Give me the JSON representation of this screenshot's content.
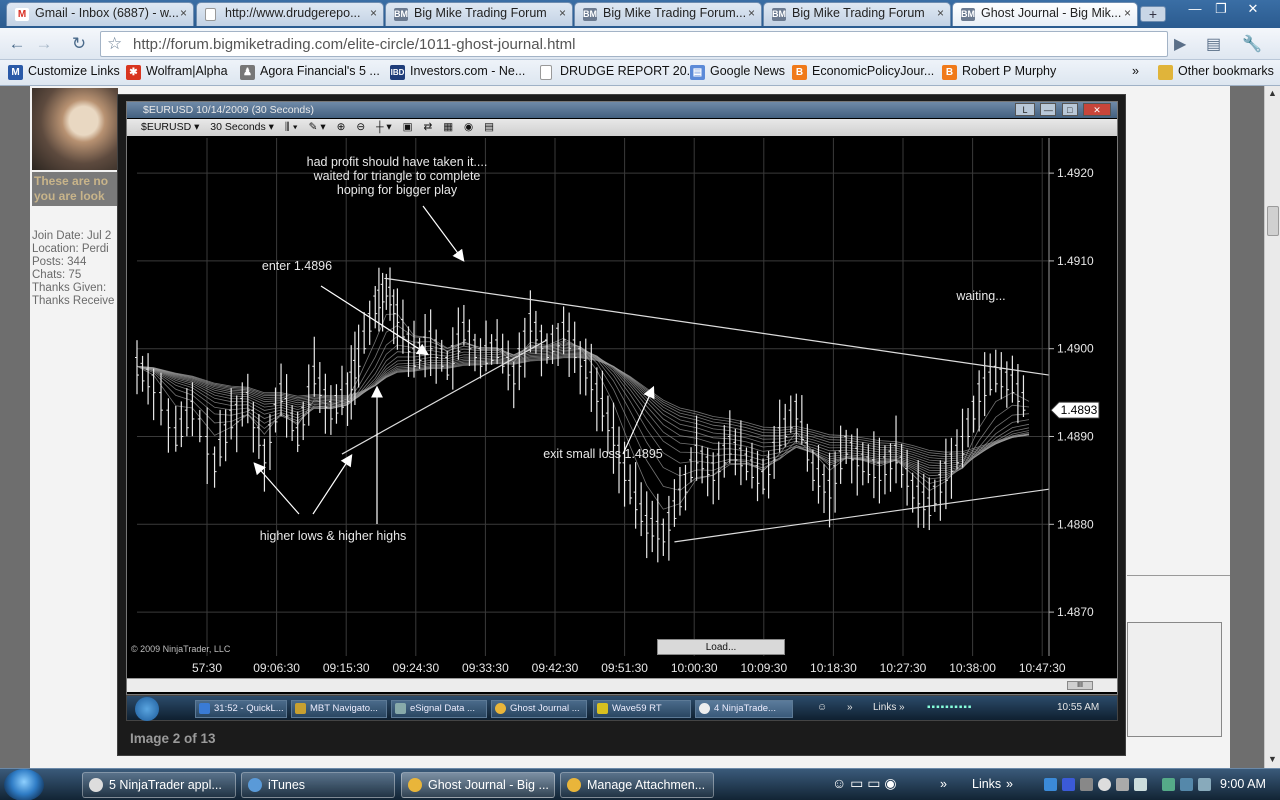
{
  "browser": {
    "tabs": [
      {
        "label": "Gmail - Inbox (6887) - w...",
        "icon": "gmail-icon",
        "active": false
      },
      {
        "label": "http://www.drudgerepo...",
        "icon": "page-icon",
        "active": false
      },
      {
        "label": "Big Mike Trading Forum",
        "icon": "bm-icon",
        "active": false
      },
      {
        "label": "Big Mike Trading Forum...",
        "icon": "bm-icon",
        "active": false
      },
      {
        "label": "Big Mike Trading Forum",
        "icon": "bm-icon",
        "active": false
      },
      {
        "label": "Ghost Journal - Big Mik...",
        "icon": "bm-icon",
        "active": true
      }
    ],
    "tab_close": "×",
    "bm_logo": "BM",
    "gmail_logo": "M",
    "new_tab": "+",
    "window_buttons": {
      "minimize": "—",
      "restore": "❐",
      "close": "✕"
    },
    "nav": {
      "back": "←",
      "forward": "→",
      "reload": "↻",
      "star": "☆",
      "go": "▶",
      "page_menu": "▤",
      "tools_menu": "🔧"
    },
    "url": "http://forum.bigmiketrading.com/elite-circle/1011-ghost-journal.html",
    "bookmarks": [
      "Customize Links",
      "Wolfram|Alpha",
      "Agora Financial's 5 ...",
      "Investors.com - Ne...",
      "DRUDGE REPORT 20...",
      "Google News",
      "EconomicPolicyJour...",
      "Robert P Murphy"
    ],
    "bookmarks_overflow": "»",
    "other_bookmarks": "Other bookmarks"
  },
  "forum": {
    "warning": "These are no you are look",
    "user_info": [
      "Join Date: Jul 2",
      "Location: Perdi",
      "Posts: 344",
      "Chats: 75",
      "Thanks Given:",
      "Thanks Receive"
    ]
  },
  "lightbox": {
    "caption": "Image 2 of 13"
  },
  "ninja": {
    "title": "$EURUSD  10/14/2009 (30 Seconds)",
    "window_buttons": [
      "L",
      "—",
      "□",
      "✕"
    ],
    "toolbar": [
      "$EURUSD ▾",
      "30 Seconds ▾",
      "⫼ ▾",
      "✎ ▾",
      "⊕",
      "⊖",
      "┼ ▾",
      "▣",
      "⇄",
      "▦",
      "◉",
      "▤"
    ],
    "copyright": "© 2009 NinjaTrader, LLC",
    "load_button": "Load...",
    "scroll_thumb": "III"
  },
  "chart_data": {
    "type": "bar",
    "instrument": "$EURUSD",
    "interval": "30 Seconds",
    "date": "10/14/2009",
    "y_ticks": [
      "1.4920",
      "1.4910",
      "1.4900",
      "1.4890",
      "1.4880",
      "1.4870"
    ],
    "ylim": [
      1.4865,
      1.4924
    ],
    "x_ticks": [
      "57:30",
      "09:06:30",
      "09:15:30",
      "09:24:30",
      "09:33:30",
      "09:42:30",
      "09:51:30",
      "10:00:30",
      "10:09:30",
      "10:18:30",
      "10:27:30",
      "10:38:00",
      "10:47:30"
    ],
    "last_price": "1.4893",
    "last_price_value": 1.4893,
    "annotations": [
      {
        "text": "had profit should have taken it.... waited for triangle to complete hoping for bigger play",
        "lines": [
          "had profit should have taken it....",
          "waited for triangle to complete",
          "hoping for bigger play"
        ]
      },
      {
        "text": "enter 1.4896"
      },
      {
        "text": "waiting..."
      },
      {
        "text": "exit small loss 1.4895"
      },
      {
        "text": "higher lows & higher highs"
      }
    ],
    "price_path": [
      [
        0,
        1.4898
      ],
      [
        6,
        1.4896
      ],
      [
        14,
        1.489
      ],
      [
        20,
        1.4893
      ],
      [
        28,
        1.4887
      ],
      [
        34,
        1.4892
      ],
      [
        40,
        1.4894
      ],
      [
        46,
        1.4888
      ],
      [
        52,
        1.4895
      ],
      [
        58,
        1.489
      ],
      [
        64,
        1.4897
      ],
      [
        70,
        1.4893
      ],
      [
        76,
        1.4895
      ],
      [
        80,
        1.4899
      ],
      [
        86,
        1.4905
      ],
      [
        90,
        1.4907
      ],
      [
        94,
        1.4904
      ],
      [
        100,
        1.4899
      ],
      [
        106,
        1.4901
      ],
      [
        112,
        1.4898
      ],
      [
        118,
        1.4902
      ],
      [
        124,
        1.4899
      ],
      [
        130,
        1.49
      ],
      [
        136,
        1.4897
      ],
      [
        142,
        1.4903
      ],
      [
        148,
        1.49
      ],
      [
        154,
        1.4902
      ],
      [
        160,
        1.4899
      ],
      [
        166,
        1.4895
      ],
      [
        172,
        1.489
      ],
      [
        178,
        1.4884
      ],
      [
        184,
        1.488
      ],
      [
        190,
        1.4879
      ],
      [
        196,
        1.4883
      ],
      [
        202,
        1.4888
      ],
      [
        208,
        1.4886
      ],
      [
        214,
        1.4889
      ],
      [
        220,
        1.4887
      ],
      [
        226,
        1.4885
      ],
      [
        232,
        1.489
      ],
      [
        238,
        1.4893
      ],
      [
        244,
        1.4886
      ],
      [
        250,
        1.4884
      ],
      [
        256,
        1.4889
      ],
      [
        262,
        1.4887
      ],
      [
        268,
        1.4886
      ],
      [
        274,
        1.4888
      ],
      [
        280,
        1.4884
      ],
      [
        286,
        1.4882
      ],
      [
        292,
        1.4886
      ],
      [
        298,
        1.4889
      ],
      [
        304,
        1.4895
      ],
      [
        310,
        1.4897
      ],
      [
        316,
        1.4896
      ],
      [
        322,
        1.4893
      ]
    ]
  },
  "inner_taskbar": {
    "buttons": [
      "31:52 - QuickL...",
      "MBT Navigato...",
      "eSignal Data ...",
      "Ghost Journal ...",
      "Wave59 RT",
      "4 NinjaTrade..."
    ],
    "overflow": "»",
    "links": "Links",
    "time": "10:55 AM"
  },
  "taskbar": {
    "buttons": [
      {
        "label": "5 NinjaTrader appl...",
        "active": false
      },
      {
        "label": "iTunes",
        "active": false
      },
      {
        "label": "Ghost Journal - Big ...",
        "active": true
      },
      {
        "label": "Manage Attachmen...",
        "active": false
      }
    ],
    "overflow": "»",
    "links": "Links",
    "time": "9:00 AM"
  },
  "colors": {
    "gmail": "#d93025",
    "bm_logo": "#6b7a90",
    "bull": "#e8e8e8",
    "ribbon": "#9a9a9a"
  }
}
